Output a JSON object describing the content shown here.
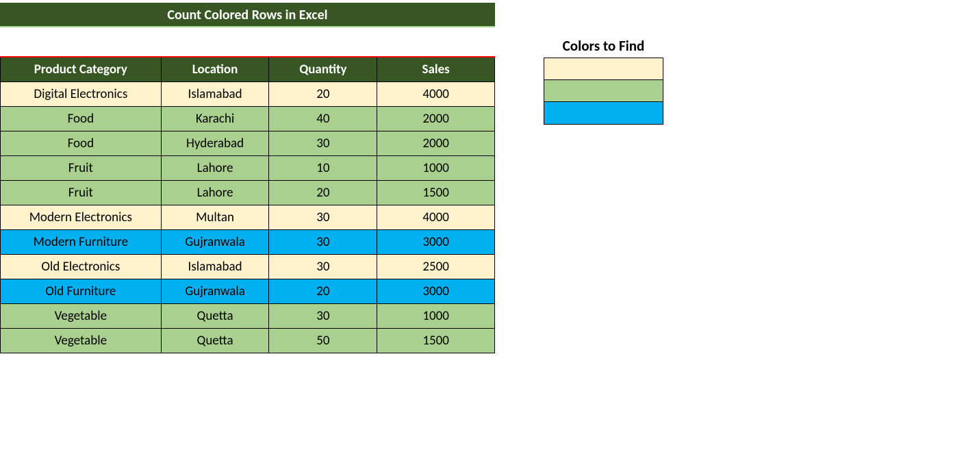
{
  "title": "Count Colored Rows in Excel",
  "colors": {
    "cream": "#fef2cc",
    "green": "#a9d08e",
    "blue": "#00b0f0"
  },
  "headers": {
    "c0": "Product Category",
    "c1": "Location",
    "c2": "Quantity",
    "c3": "Sales"
  },
  "rows": [
    {
      "c0": "Digital Electronics",
      "c1": "Islamabad",
      "c2": "20",
      "c3": "4000",
      "color": "cream"
    },
    {
      "c0": "Food",
      "c1": "Karachi",
      "c2": "40",
      "c3": "2000",
      "color": "green"
    },
    {
      "c0": "Food",
      "c1": "Hyderabad",
      "c2": "30",
      "c3": "2000",
      "color": "green"
    },
    {
      "c0": "Fruit",
      "c1": "Lahore",
      "c2": "10",
      "c3": "1000",
      "color": "green"
    },
    {
      "c0": "Fruit",
      "c1": "Lahore",
      "c2": "20",
      "c3": "1500",
      "color": "green"
    },
    {
      "c0": "Modern Electronics",
      "c1": "Multan",
      "c2": "30",
      "c3": "4000",
      "color": "cream"
    },
    {
      "c0": "Modern Furniture",
      "c1": "Gujranwala",
      "c2": "30",
      "c3": "3000",
      "color": "blue"
    },
    {
      "c0": "Old Electronics",
      "c1": "Islamabad",
      "c2": "30",
      "c3": "2500",
      "color": "cream"
    },
    {
      "c0": "Old Furniture",
      "c1": "Gujranwala",
      "c2": "20",
      "c3": "3000",
      "color": "blue"
    },
    {
      "c0": "Vegetable",
      "c1": "Quetta",
      "c2": "30",
      "c3": "1000",
      "color": "green"
    },
    {
      "c0": "Vegetable",
      "c1": "Quetta",
      "c2": "50",
      "c3": "1500",
      "color": "green"
    }
  ],
  "colors_panel": {
    "label": "Colors to Find",
    "swatches": [
      "cream",
      "green",
      "blue"
    ]
  }
}
